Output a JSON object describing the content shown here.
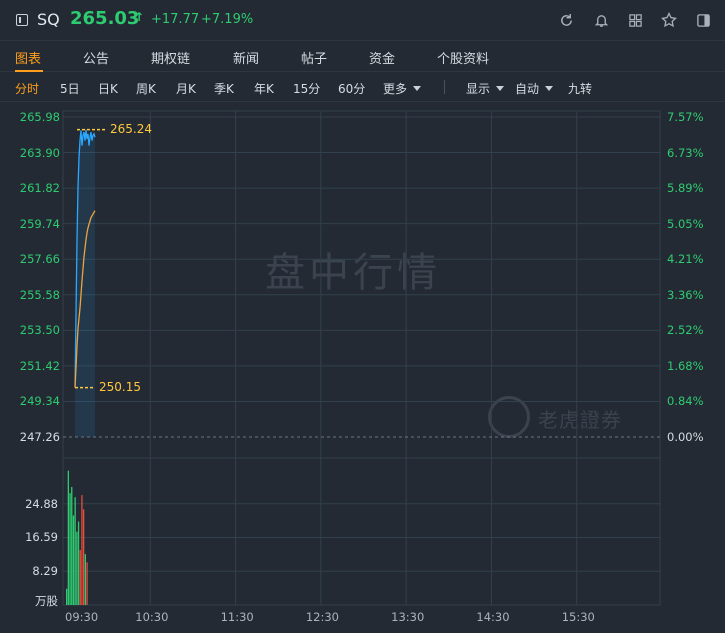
{
  "header": {
    "symbol": "SQ",
    "price": "265.03",
    "arrow": "↑",
    "change": "+17.77",
    "change_pct": "+7.19%",
    "up_color": "#2ecc71",
    "icons": [
      "refresh-icon",
      "bell-icon",
      "grid-icon",
      "star-icon",
      "panel-icon"
    ]
  },
  "tabs": [
    "图表",
    "公告",
    "期权链",
    "新闻",
    "帖子",
    "资金",
    "个股资料"
  ],
  "active_tab": "图表",
  "subtabs": [
    "分时",
    "5日",
    "日K",
    "周K",
    "月K",
    "季K",
    "年K",
    "15分",
    "60分",
    "更多"
  ],
  "active_subtab": "分时",
  "controls": [
    "显示",
    "自动",
    "九转"
  ],
  "accent_color": "#ff9f1c",
  "watermark": "盘中行情",
  "brand": "老虎證券",
  "chart_data": {
    "type": "line",
    "y_ticks": [
      "265.98",
      "263.90",
      "261.82",
      "259.74",
      "257.66",
      "255.58",
      "253.50",
      "251.42",
      "249.34",
      "247.26"
    ],
    "y_pct_ticks": [
      "7.57%",
      "6.73%",
      "5.89%",
      "5.05%",
      "4.21%",
      "3.36%",
      "2.52%",
      "1.68%",
      "0.84%",
      "0.00%"
    ],
    "ylim": [
      247.26,
      265.98
    ],
    "prev_close": 247.26,
    "x_ticks": [
      "09:30",
      "10:30",
      "11:30",
      "12:30",
      "13:30",
      "14:30",
      "15:30"
    ],
    "high_label": "265.24",
    "low_label": "250.15",
    "series": [
      {
        "color": "#2aa8ff",
        "x": [
          0,
          1,
          2,
          3,
          4,
          5,
          6,
          7,
          8,
          9,
          10,
          11,
          12,
          13,
          14,
          15,
          16,
          17,
          18,
          19,
          20
        ],
        "values": [
          250.2,
          254.5,
          258.8,
          261.9,
          263.6,
          264.6,
          265.2,
          264.3,
          264.9,
          265.1,
          264.6,
          265.24,
          264.7,
          265.0,
          264.3,
          264.8,
          265.1,
          264.6,
          264.9,
          265.0,
          264.8
        ]
      },
      {
        "color": "#f0a33a",
        "x": [
          0,
          1,
          2,
          3,
          4,
          5,
          6,
          7,
          8,
          9,
          10,
          11,
          12,
          13,
          14,
          15,
          16,
          17,
          18,
          19,
          20
        ],
        "values": [
          250.15,
          251.3,
          252.6,
          253.6,
          254.2,
          254.8,
          255.6,
          256.4,
          257.1,
          257.8,
          258.3,
          258.8,
          259.2,
          259.5,
          259.7,
          259.9,
          260.1,
          260.2,
          260.3,
          260.4,
          260.5
        ]
      }
    ],
    "volume": {
      "unit": "万股",
      "y_ticks": [
        "24.88",
        "16.59",
        "8.29"
      ],
      "ylim": [
        0,
        33.17
      ],
      "up_color": "#2ecc71",
      "down_color": "#e74c3c",
      "bars": [
        {
          "v": 4.0,
          "up": true
        },
        {
          "v": 33.0,
          "up": true
        },
        {
          "v": 27.5,
          "up": true
        },
        {
          "v": 29.0,
          "up": true
        },
        {
          "v": 22.0,
          "up": true
        },
        {
          "v": 26.5,
          "up": true
        },
        {
          "v": 18.0,
          "up": true
        },
        {
          "v": 20.5,
          "up": true
        },
        {
          "v": 13.5,
          "up": false
        },
        {
          "v": 27.0,
          "up": false
        },
        {
          "v": 23.5,
          "up": false
        },
        {
          "v": 12.5,
          "up": true
        },
        {
          "v": 10.5,
          "up": false
        }
      ]
    }
  }
}
